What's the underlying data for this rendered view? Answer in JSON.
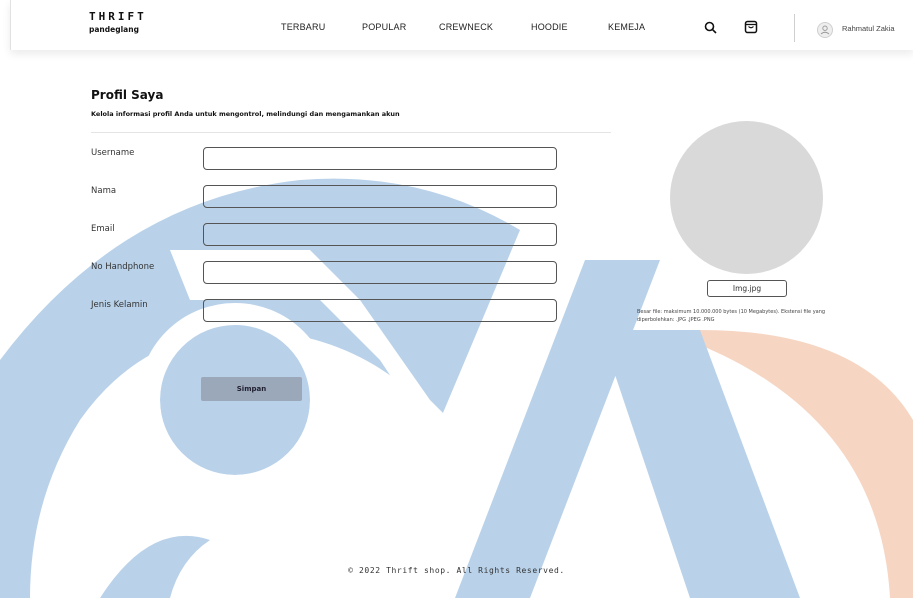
{
  "brand": {
    "title": "THRIFT",
    "subtitle": "pandeglang"
  },
  "nav": [
    {
      "label": "TERBARU"
    },
    {
      "label": "POPULAR"
    },
    {
      "label": "CREWNECK"
    },
    {
      "label": "HOODIE"
    },
    {
      "label": "KEMEJA"
    }
  ],
  "header_icons": [
    "search-icon",
    "shopping-bag-icon",
    "user-icon"
  ],
  "user": {
    "name": "Rahmatul Zakia"
  },
  "profile": {
    "title": "Profil Saya",
    "subtitle": "Kelola informasi profil Anda untuk mengontrol, melindungi dan mengamankan akun",
    "fields": [
      {
        "label": "Username",
        "value": ""
      },
      {
        "label": "Nama",
        "value": ""
      },
      {
        "label": "Email",
        "value": ""
      },
      {
        "label": "No Handphone",
        "value": ""
      },
      {
        "label": "Jenis Kelamin",
        "value": ""
      }
    ],
    "save_label": "Simpan",
    "file_button_label": "Img.jpg",
    "file_note": "Besar file: maksimum 10.000.000 bytes (10 Megabytes). Ekstensi file yang diperbolehkan: .JPG .JPEG .PNG"
  },
  "footer": {
    "text": "© 2022 Thrift shop. All Rights Reserved."
  },
  "colors": {
    "watermark_blue": "#b9d2ea",
    "watermark_orange": "#f6d6c3",
    "save_button": "#9aa8ba",
    "avatar_placeholder": "#d9d9d9"
  }
}
